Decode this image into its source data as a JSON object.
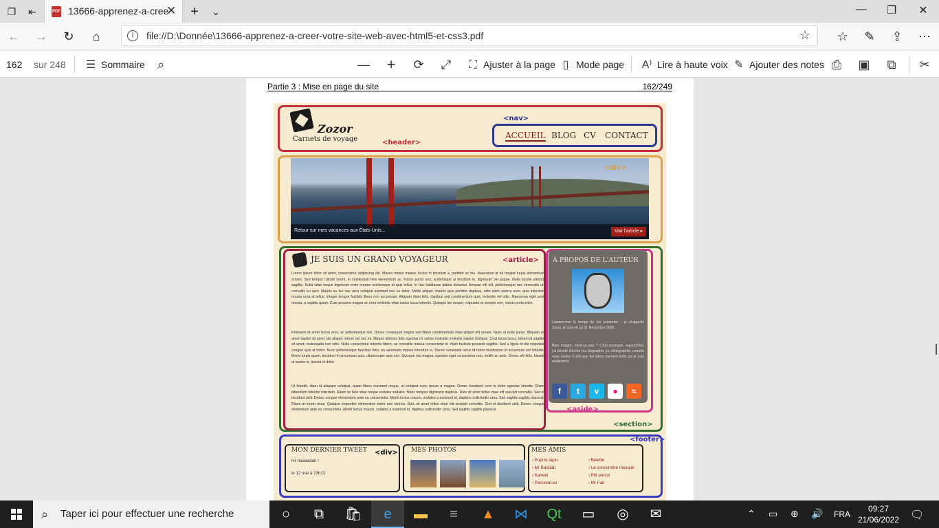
{
  "browser": {
    "tab_title": "13666-apprenez-a-cree",
    "url": "file://D:\\Donnée\\13666-apprenez-a-creer-votre-site-web-avec-html5-et-css3.pdf"
  },
  "pdf_toolbar": {
    "page_current": "162",
    "page_total": "sur 248",
    "contents_label": "Sommaire",
    "fit_label": "Ajuster à la page",
    "page_mode_label": "Mode page",
    "read_aloud_label": "Lire à haute voix",
    "add_notes_label": "Ajouter des notes"
  },
  "pdf_page": {
    "header_left": "Partie 3 : Mise en page du site",
    "header_right": "162/249",
    "figure": {
      "tags": {
        "nav": "<nav>",
        "header": "<header>",
        "div_banner": "<div>",
        "article": "<article>",
        "aside": "<aside>",
        "section": "<section>",
        "footer": "<footer>",
        "div_footer": "<div>"
      },
      "logo_name": "Zozor",
      "logo_tagline": "Carnets de voyage",
      "nav_links": [
        "ACCUEIL",
        "BLOG",
        "CV",
        "CONTACT"
      ],
      "banner_caption": "Retour sur mes vacances aux États-Unis...",
      "banner_button": "Voir l'article ▸",
      "article_title": "JE SUIS UN GRAND VOYAGEUR",
      "article_paragraphs": [
        "Lorem ipsum dolor sit amet, consectetur adipiscing elit. Mauris metus massa, luctus in tincidunt a, porttitor ac leo. Maecenas at mi feugiat turpis elementum ornare. Sed tempor rutrum lorem, in vestibulum felis elementum ac. Fusce purus orci, scelerisque ut tincidunt in, dignissim vel augue. Nulla iaculis ultrices sagittis. Nulla vitae neque dignissim enim tempor scelerisque at quis tellus. In hac habitasse platea dictumst. Aenean elit elit, pellentesque nec venenatis ut, convallis eu sem. Mauris eu leo nec arcu volutpat euismod nec eu dolor. Morbi aliquet, mauris quis porttitor dapibus, odio enim viverra eros, quis interdum massa urna at tellus. Integer tempor facilisis libero non accumsan. Aliquam diam felis, dapibus sed condimentum quis, molestie vel odio. Maecenas eget ante massa, a sagittis quam. Cras posuere magna ac urna molestie vitae luctus lacus lobortis. Quisque leo neque, vulputate at semper non, varius porta enim.",
        "Praesent sit amet lectus eros, ac pellentesque nisi. Donec consequat magna sed libero condimentum vitae aliquet elit ornare. Nunc at nulla purus. Aliquam sit amet sapien sit amet nisi aliquet rutrum vel nec mi. Mauris ultricies felis egestas mi varius molestie molestie sapien tristique. Cras lacus lacus, rutrum id sagittis sit amet, malesuada nec odio. Nulla consectetur lobortis libero, ac convallis massa consectetur in. Nam facilisis posuere sagittis. Sed a ligula id dui vulputate congue quis at tortor. Nunc pellentesque faucibus felis, eu venenatis massa interdum in. Donec venenatis lacus id tortor vestibulum id accumsan est lobortis. Morbi turpis quam, tincidunt in accumsan quis, ullamcorper quis orci. Quisque nisi magna, egestas eget consectetur non, mollis ac ante. Donec elit felis, blandit at auctor in, lacinia et dolor.",
        "Ut blandit, diam id aliquam volutpat, quam libero euismod neque, ut volutpat nunc ipsum a magna. Donec hendrerit sem in dolor egestas lobortis. Etiam bibendum lobortis interdum. Etiam ac felis vitae neque sodales sodales. Nunc tempus dignissim dapibus. Duis sit amet tellus vitae elit suscipit convallis. Sed et tincidunt velit. Donec congue elementum ante eu consectetur. Morbi lectus mauris, sodales a euismod id, dapibus sollicitudin urna. Sed sagittis sagittis placerat. Etiam at lorem risus. Quisque imperdiet elementum tortor nec viverra. Duis sit amet tellus vitae elit suscipit convallis. Sed et tincidunt velit. Donec congue elementum ante eu consectetur. Morbi lectus mauris, sodales a euismod id, dapibus sollicitudin urna. Sed sagittis sagittis placerat."
      ],
      "aside_title": "À PROPOS DE L'AUTEUR",
      "aside_text_1": "Laissez-moi le temps de me présenter : je m'appelle Zozor, je suis né un 21 Novembre 2005.",
      "aside_text_2": "Bien maigre, n'est-ce pas ? C'est pourquoi, aujourd'hui, j'ai décidé d'écrire ma biographie (ou zBiographie, comme vous voulez !) afin que les zéros sachent enfin qui je suis réellement.",
      "social_icons": [
        "facebook-icon",
        "twitter-icon",
        "vimeo-icon",
        "flickr-icon",
        "rss-icon"
      ],
      "footer": {
        "tweet_title": "MON DERNIER TWEET",
        "tweet_text": "Hii haaaaaan !",
        "tweet_date": "le 12 mai à 23h12",
        "photos_title": "MES PHOTOS",
        "friends_title": "MES AMIS",
        "friends_col1": [
          "› Pupi le lapin",
          "› Mr Baobab",
          "› Kaiwaii",
          "› Perceval.eu"
        ],
        "friends_col2": [
          "› Belette",
          "› Le concombre masqué",
          "› Ptit prince",
          "› Mr Fan"
        ]
      }
    }
  },
  "taskbar": {
    "search_placeholder": "Taper ici pour effectuer une recherche",
    "language": "FRA",
    "time": "09:27",
    "date": "21/06/2022"
  },
  "colors": {
    "header_box": "#c0303a",
    "nav_box": "#2a3a8c",
    "banner_box": "#d9a04c",
    "section_box": "#2f6e2f",
    "article_box": "#a02040",
    "aside_box": "#d0328a",
    "footer_box": "#3a3ac0"
  }
}
